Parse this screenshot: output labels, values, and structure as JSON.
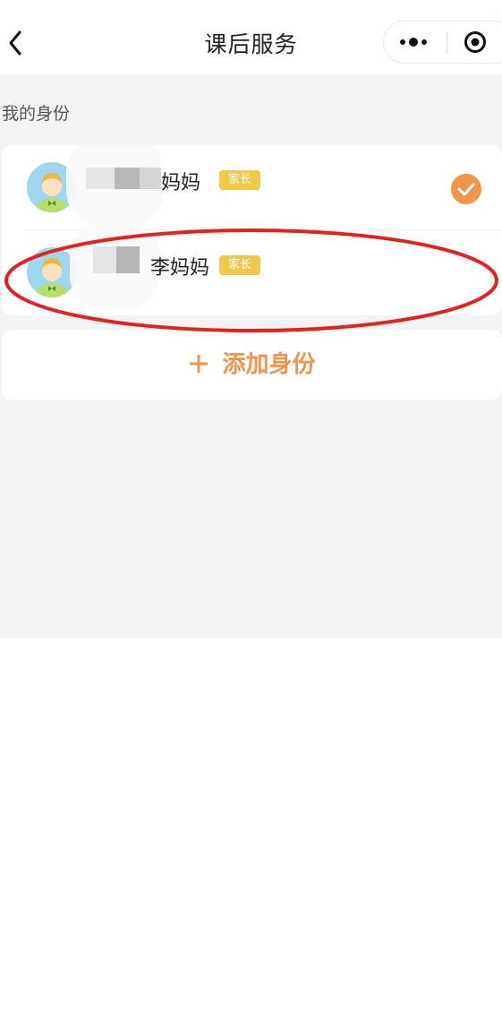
{
  "nav": {
    "title": "课后服务",
    "back_icon": "chevron-left-icon",
    "more_icon": "more-dots-icon",
    "close_icon": "target-circle-icon"
  },
  "section": {
    "label": "我的身份"
  },
  "identities": [
    {
      "name_visible": "妈妈",
      "badge": "家长",
      "selected": true,
      "avatar_icon": "child-avatar-icon"
    },
    {
      "name_visible": "李妈妈",
      "badge": "家长",
      "selected": false,
      "avatar_icon": "child-avatar-icon"
    }
  ],
  "add": {
    "label": "添加身份",
    "icon": "plus-icon"
  },
  "colors": {
    "accent": "#f0954a",
    "badge": "#f0c94a",
    "annotation": "#e8201c",
    "background": "#f4f4f4"
  }
}
